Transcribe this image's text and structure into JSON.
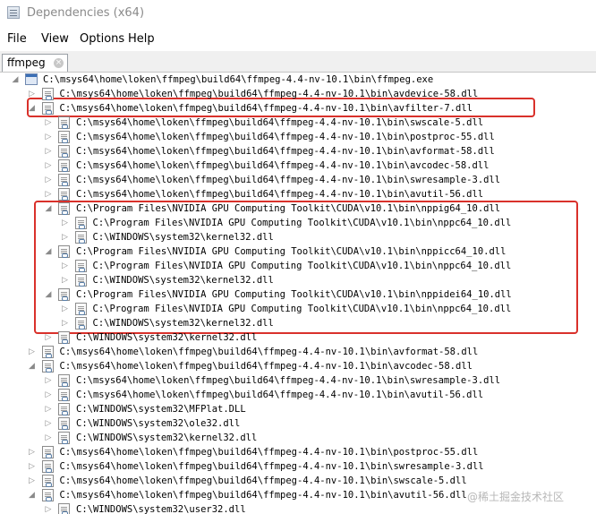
{
  "window": {
    "title": "Dependencies (x64)"
  },
  "menu": {
    "file": "File",
    "view": "View",
    "options": "Options",
    "help": "Help"
  },
  "tab": {
    "label": "ffmpeg",
    "close_glyph": "×"
  },
  "tree_rows": [
    {
      "text": "C:\\msys64\\home\\loken\\ffmpeg\\build64\\ffmpeg-4.4-nv-10.1\\bin\\ffmpeg.exe",
      "depth": 0,
      "state": "expanded",
      "icon": "exe-icon"
    },
    {
      "text": "C:\\msys64\\home\\loken\\ffmpeg\\build64\\ffmpeg-4.4-nv-10.1\\bin\\avdevice-58.dll",
      "depth": 1,
      "state": "collapsed",
      "icon": "dll-icon"
    },
    {
      "text": "C:\\msys64\\home\\loken\\ffmpeg\\build64\\ffmpeg-4.4-nv-10.1\\bin\\avfilter-7.dll",
      "depth": 1,
      "state": "expanded",
      "icon": "dll-icon"
    },
    {
      "text": "C:\\msys64\\home\\loken\\ffmpeg\\build64\\ffmpeg-4.4-nv-10.1\\bin\\swscale-5.dll",
      "depth": 2,
      "state": "collapsed",
      "icon": "dll-icon"
    },
    {
      "text": "C:\\msys64\\home\\loken\\ffmpeg\\build64\\ffmpeg-4.4-nv-10.1\\bin\\postproc-55.dll",
      "depth": 2,
      "state": "collapsed",
      "icon": "dll-icon"
    },
    {
      "text": "C:\\msys64\\home\\loken\\ffmpeg\\build64\\ffmpeg-4.4-nv-10.1\\bin\\avformat-58.dll",
      "depth": 2,
      "state": "collapsed",
      "icon": "dll-icon"
    },
    {
      "text": "C:\\msys64\\home\\loken\\ffmpeg\\build64\\ffmpeg-4.4-nv-10.1\\bin\\avcodec-58.dll",
      "depth": 2,
      "state": "collapsed",
      "icon": "dll-icon"
    },
    {
      "text": "C:\\msys64\\home\\loken\\ffmpeg\\build64\\ffmpeg-4.4-nv-10.1\\bin\\swresample-3.dll",
      "depth": 2,
      "state": "collapsed",
      "icon": "dll-icon"
    },
    {
      "text": "C:\\msys64\\home\\loken\\ffmpeg\\build64\\ffmpeg-4.4-nv-10.1\\bin\\avutil-56.dll",
      "depth": 2,
      "state": "collapsed",
      "icon": "dll-icon"
    },
    {
      "text": "C:\\Program Files\\NVIDIA GPU Computing Toolkit\\CUDA\\v10.1\\bin\\nppig64_10.dll",
      "depth": 2,
      "state": "expanded",
      "icon": "dll-icon"
    },
    {
      "text": "C:\\Program Files\\NVIDIA GPU Computing Toolkit\\CUDA\\v10.1\\bin\\nppc64_10.dll",
      "depth": 3,
      "state": "collapsed",
      "icon": "dll-icon"
    },
    {
      "text": "C:\\WINDOWS\\system32\\kernel32.dll",
      "depth": 3,
      "state": "collapsed",
      "icon": "dll-icon"
    },
    {
      "text": "C:\\Program Files\\NVIDIA GPU Computing Toolkit\\CUDA\\v10.1\\bin\\nppicc64_10.dll",
      "depth": 2,
      "state": "expanded",
      "icon": "dll-icon"
    },
    {
      "text": "C:\\Program Files\\NVIDIA GPU Computing Toolkit\\CUDA\\v10.1\\bin\\nppc64_10.dll",
      "depth": 3,
      "state": "collapsed",
      "icon": "dll-icon"
    },
    {
      "text": "C:\\WINDOWS\\system32\\kernel32.dll",
      "depth": 3,
      "state": "collapsed",
      "icon": "dll-icon"
    },
    {
      "text": "C:\\Program Files\\NVIDIA GPU Computing Toolkit\\CUDA\\v10.1\\bin\\nppidei64_10.dll",
      "depth": 2,
      "state": "expanded",
      "icon": "dll-icon"
    },
    {
      "text": "C:\\Program Files\\NVIDIA GPU Computing Toolkit\\CUDA\\v10.1\\bin\\nppc64_10.dll",
      "depth": 3,
      "state": "collapsed",
      "icon": "dll-icon"
    },
    {
      "text": "C:\\WINDOWS\\system32\\kernel32.dll",
      "depth": 3,
      "state": "collapsed",
      "icon": "dll-icon"
    },
    {
      "text": "C:\\WINDOWS\\system32\\kernel32.dll",
      "depth": 2,
      "state": "collapsed",
      "icon": "dll-icon"
    },
    {
      "text": "C:\\msys64\\home\\loken\\ffmpeg\\build64\\ffmpeg-4.4-nv-10.1\\bin\\avformat-58.dll",
      "depth": 1,
      "state": "collapsed",
      "icon": "dll-icon"
    },
    {
      "text": "C:\\msys64\\home\\loken\\ffmpeg\\build64\\ffmpeg-4.4-nv-10.1\\bin\\avcodec-58.dll",
      "depth": 1,
      "state": "expanded",
      "icon": "dll-icon"
    },
    {
      "text": "C:\\msys64\\home\\loken\\ffmpeg\\build64\\ffmpeg-4.4-nv-10.1\\bin\\swresample-3.dll",
      "depth": 2,
      "state": "collapsed",
      "icon": "dll-icon"
    },
    {
      "text": "C:\\msys64\\home\\loken\\ffmpeg\\build64\\ffmpeg-4.4-nv-10.1\\bin\\avutil-56.dll",
      "depth": 2,
      "state": "collapsed",
      "icon": "dll-icon"
    },
    {
      "text": "C:\\WINDOWS\\system32\\MFPlat.DLL",
      "depth": 2,
      "state": "collapsed",
      "icon": "dll-icon"
    },
    {
      "text": "C:\\WINDOWS\\system32\\ole32.dll",
      "depth": 2,
      "state": "collapsed",
      "icon": "dll-icon"
    },
    {
      "text": "C:\\WINDOWS\\system32\\kernel32.dll",
      "depth": 2,
      "state": "collapsed",
      "icon": "dll-icon"
    },
    {
      "text": "C:\\msys64\\home\\loken\\ffmpeg\\build64\\ffmpeg-4.4-nv-10.1\\bin\\postproc-55.dll",
      "depth": 1,
      "state": "collapsed",
      "icon": "dll-icon"
    },
    {
      "text": "C:\\msys64\\home\\loken\\ffmpeg\\build64\\ffmpeg-4.4-nv-10.1\\bin\\swresample-3.dll",
      "depth": 1,
      "state": "collapsed",
      "icon": "dll-icon"
    },
    {
      "text": "C:\\msys64\\home\\loken\\ffmpeg\\build64\\ffmpeg-4.4-nv-10.1\\bin\\swscale-5.dll",
      "depth": 1,
      "state": "collapsed",
      "icon": "dll-icon"
    },
    {
      "text": "C:\\msys64\\home\\loken\\ffmpeg\\build64\\ffmpeg-4.4-nv-10.1\\bin\\avutil-56.dll",
      "depth": 1,
      "state": "expanded",
      "icon": "dll-icon"
    },
    {
      "text": "C:\\WINDOWS\\system32\\user32.dll",
      "depth": 2,
      "state": "collapsed",
      "icon": "dll-icon"
    }
  ],
  "annotations": {
    "highlight_color": "#d9312b"
  },
  "watermark": "@稀土掘金技术社区"
}
